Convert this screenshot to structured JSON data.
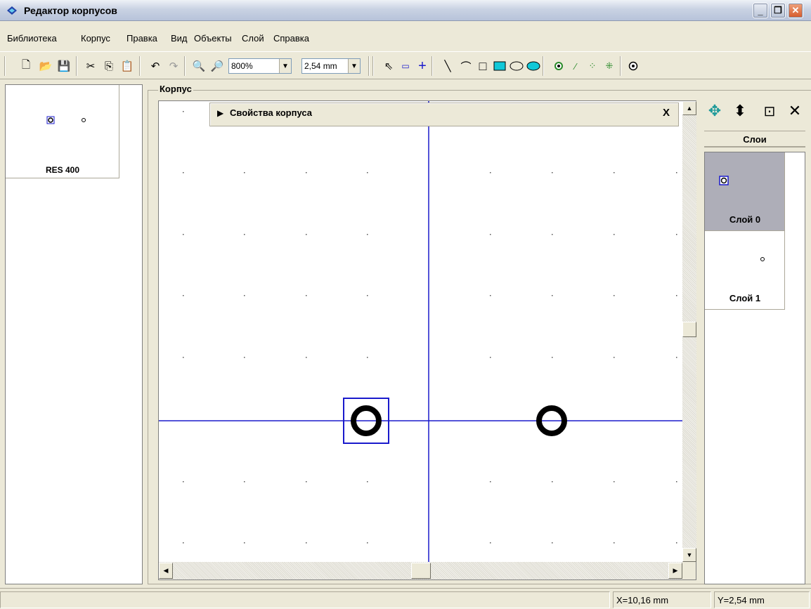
{
  "window": {
    "title": "Редактор корпусов"
  },
  "menu": [
    "Библиотека",
    "Корпус",
    "Правка",
    "Вид",
    "Объекты",
    "Слой",
    "Справка"
  ],
  "toolbar": {
    "zoom_value": "800%",
    "grid_value": "2,54 mm"
  },
  "library": {
    "item_name": "RES 400"
  },
  "package_group": {
    "label": "Корпус"
  },
  "properties_panel": {
    "label": "Свойства корпуса",
    "close": "X"
  },
  "layers": {
    "header": "Слои",
    "items": [
      {
        "name": "Слой 0",
        "selected": true
      },
      {
        "name": "Слой 1",
        "selected": false
      }
    ]
  },
  "status": {
    "x": "X=10,16 mm",
    "y": "Y=2,54 mm"
  },
  "colors": {
    "accent": "#1a1acc",
    "pad_selected_border": "#1a1acc",
    "pad": "#000000",
    "selected_layer_bg": "#aeaeb8"
  }
}
